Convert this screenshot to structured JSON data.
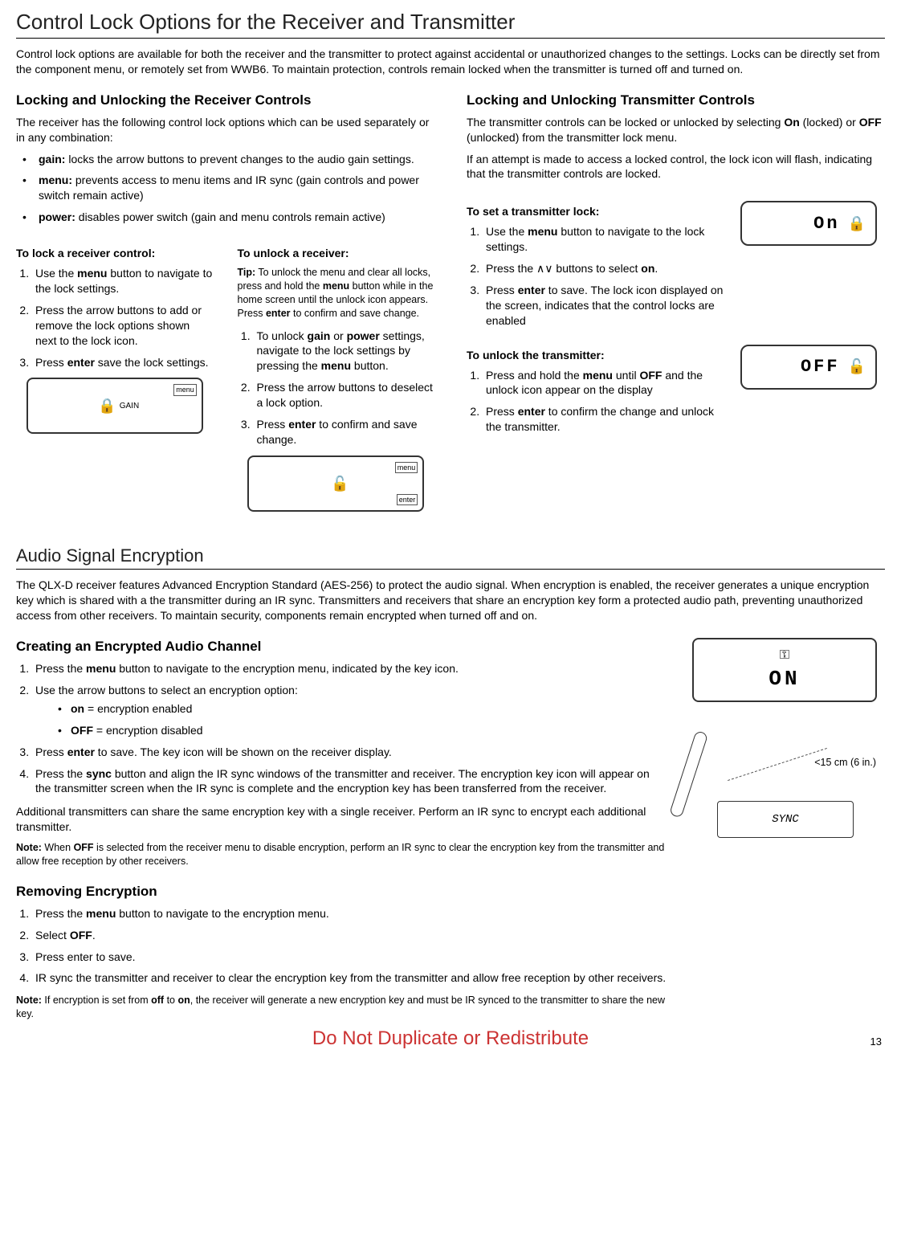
{
  "page": {
    "title": "Control Lock Options for the Receiver and Transmitter",
    "intro": "Control lock options are available for both the receiver and the transmitter to protect against accidental or unauthorized changes to the settings. Locks can be directly set from the component menu, or remotely set from WWB6. To maintain protection, controls remain locked when the transmitter is turned off and turned on.",
    "number": "13",
    "watermark": "Do Not Duplicate or Redistribute"
  },
  "receiver": {
    "heading": "Locking and Unlocking the Receiver Controls",
    "intro": "The receiver has the following control lock options which can be used separately or in any combination:",
    "options": {
      "gain": "locks the arrow buttons to prevent changes to the audio gain settings.",
      "menu": "prevents access to menu items and IR sync (gain controls and power switch remain active)",
      "power": "disables power switch (gain and menu controls remain active)"
    },
    "lock": {
      "heading": "To lock a receiver control:",
      "s1_a": "Use the ",
      "s1_b": "menu",
      "s1_c": " button to navigate to the lock settings.",
      "s2": "Press the arrow buttons to add or remove the lock options shown next to the lock icon.",
      "s3_a": "Press ",
      "s3_b": "enter",
      "s3_c": " save the lock settings."
    },
    "unlock": {
      "heading": "To unlock a receiver:",
      "tip_label": "Tip:",
      "tip_a": " To unlock the menu and clear all locks, press and hold the ",
      "tip_b": "menu",
      "tip_c": " button while in the home screen until the unlock icon appears. Press ",
      "tip_d": "enter",
      "tip_e": " to confirm and save change.",
      "s1_a": "To unlock ",
      "s1_b": "gain",
      "s1_c": " or ",
      "s1_d": "power",
      "s1_e": " settings, navigate to the lock settings by pressing the ",
      "s1_f": "menu",
      "s1_g": " button.",
      "s2": "Press the arrow buttons to deselect a lock option.",
      "s3_a": "Press ",
      "s3_b": "enter",
      "s3_c": " to confirm and save change."
    },
    "display_label": "GAIN"
  },
  "transmitter": {
    "heading": "Locking and Unlocking Transmitter Controls",
    "intro_a": "The transmitter controls can be locked or unlocked by selecting ",
    "intro_b": "On",
    "intro_c": " (locked) or ",
    "intro_d": "OFF",
    "intro_e": " (unlocked) from the transmitter lock menu.",
    "flash": "If an attempt is made to access a locked control, the lock icon will flash, indicating that the transmitter controls are locked.",
    "set": {
      "heading": "To set a transmitter lock:",
      "s1_a": "Use the ",
      "s1_b": "menu",
      "s1_c": " button to navigate to the lock settings.",
      "s2_a": "Press the ",
      "s2_b": "∧∨",
      "s2_c": " buttons to select ",
      "s2_d": "on",
      "s2_e": ".",
      "s3_a": "Press ",
      "s3_b": "enter",
      "s3_c": " to save. The lock icon displayed on the screen, indicates that the control locks are enabled"
    },
    "unlock": {
      "heading": "To unlock the transmitter:",
      "s1_a": "Press and hold the ",
      "s1_b": "menu",
      "s1_c": " until ",
      "s1_d": "OFF",
      "s1_e": " and the unlock icon appear on the display",
      "s2_a": "Press ",
      "s2_b": "enter",
      "s2_c": " to confirm the change and unlock the transmitter."
    },
    "lcd_on": "On",
    "lcd_off": "OFF"
  },
  "encryption": {
    "heading": "Audio Signal Encryption",
    "intro": "The QLX-D receiver features Advanced Encryption Standard (AES-256) to protect the audio signal. When encryption is enabled, the receiver generates a unique encryption key which is shared with a the transmitter during an IR sync. Transmitters and receivers that share an encryption key form a protected audio path, preventing unauthorized access from other receivers. To maintain security, components remain encrypted when turned off and on.",
    "create": {
      "heading": "Creating an Encrypted Audio Channel",
      "s1_a": "Press the ",
      "s1_b": "menu",
      "s1_c": " button to navigate to the encryption menu, indicated by the key icon.",
      "s2": "Use the arrow buttons to select an encryption option:",
      "opt_on_label": "on",
      "opt_on_text": " = encryption enabled",
      "opt_off_label": "OFF",
      "opt_off_text": " = encryption disabled",
      "s3_a": "Press ",
      "s3_b": "enter",
      "s3_c": " to save. The key icon will be shown on the receiver display.",
      "s4_a": "Press the ",
      "s4_b": "sync",
      "s4_c": " button and align the IR sync windows of the transmitter and receiver. The encryption key icon will appear on the transmitter screen when the IR sync is complete and the encryption key has been transferred from the receiver.",
      "additional": "Additional transmitters can share the same encryption key with a single receiver. Perform an IR sync to encrypt each additional transmitter.",
      "note_label": "Note:",
      "note_a": " When ",
      "note_b": "OFF",
      "note_c": " is selected from the receiver menu to disable encryption, perform an IR sync to clear the encryption key from the transmitter and allow free reception by other receivers."
    },
    "remove": {
      "heading": "Removing Encryption",
      "s1_a": "Press the ",
      "s1_b": "menu",
      "s1_c": " button to navigate to the encryption menu.",
      "s2_a": "Select ",
      "s2_b": "OFF",
      "s2_c": ".",
      "s3": "Press enter to save.",
      "s4": "IR sync the transmitter and receiver to clear the encryption key from the transmitter and allow free reception by other receivers.",
      "note_label": "Note:",
      "note_a": " If encryption is set from ",
      "note_b": "off",
      "note_c": " to ",
      "note_d": "on",
      "note_e": ", the receiver will generate a new encryption key and must be IR synced to the transmitter to share the new key."
    },
    "display_on": "ON",
    "sync_label": "SYNC",
    "distance": "<15 cm (6 in.)"
  }
}
